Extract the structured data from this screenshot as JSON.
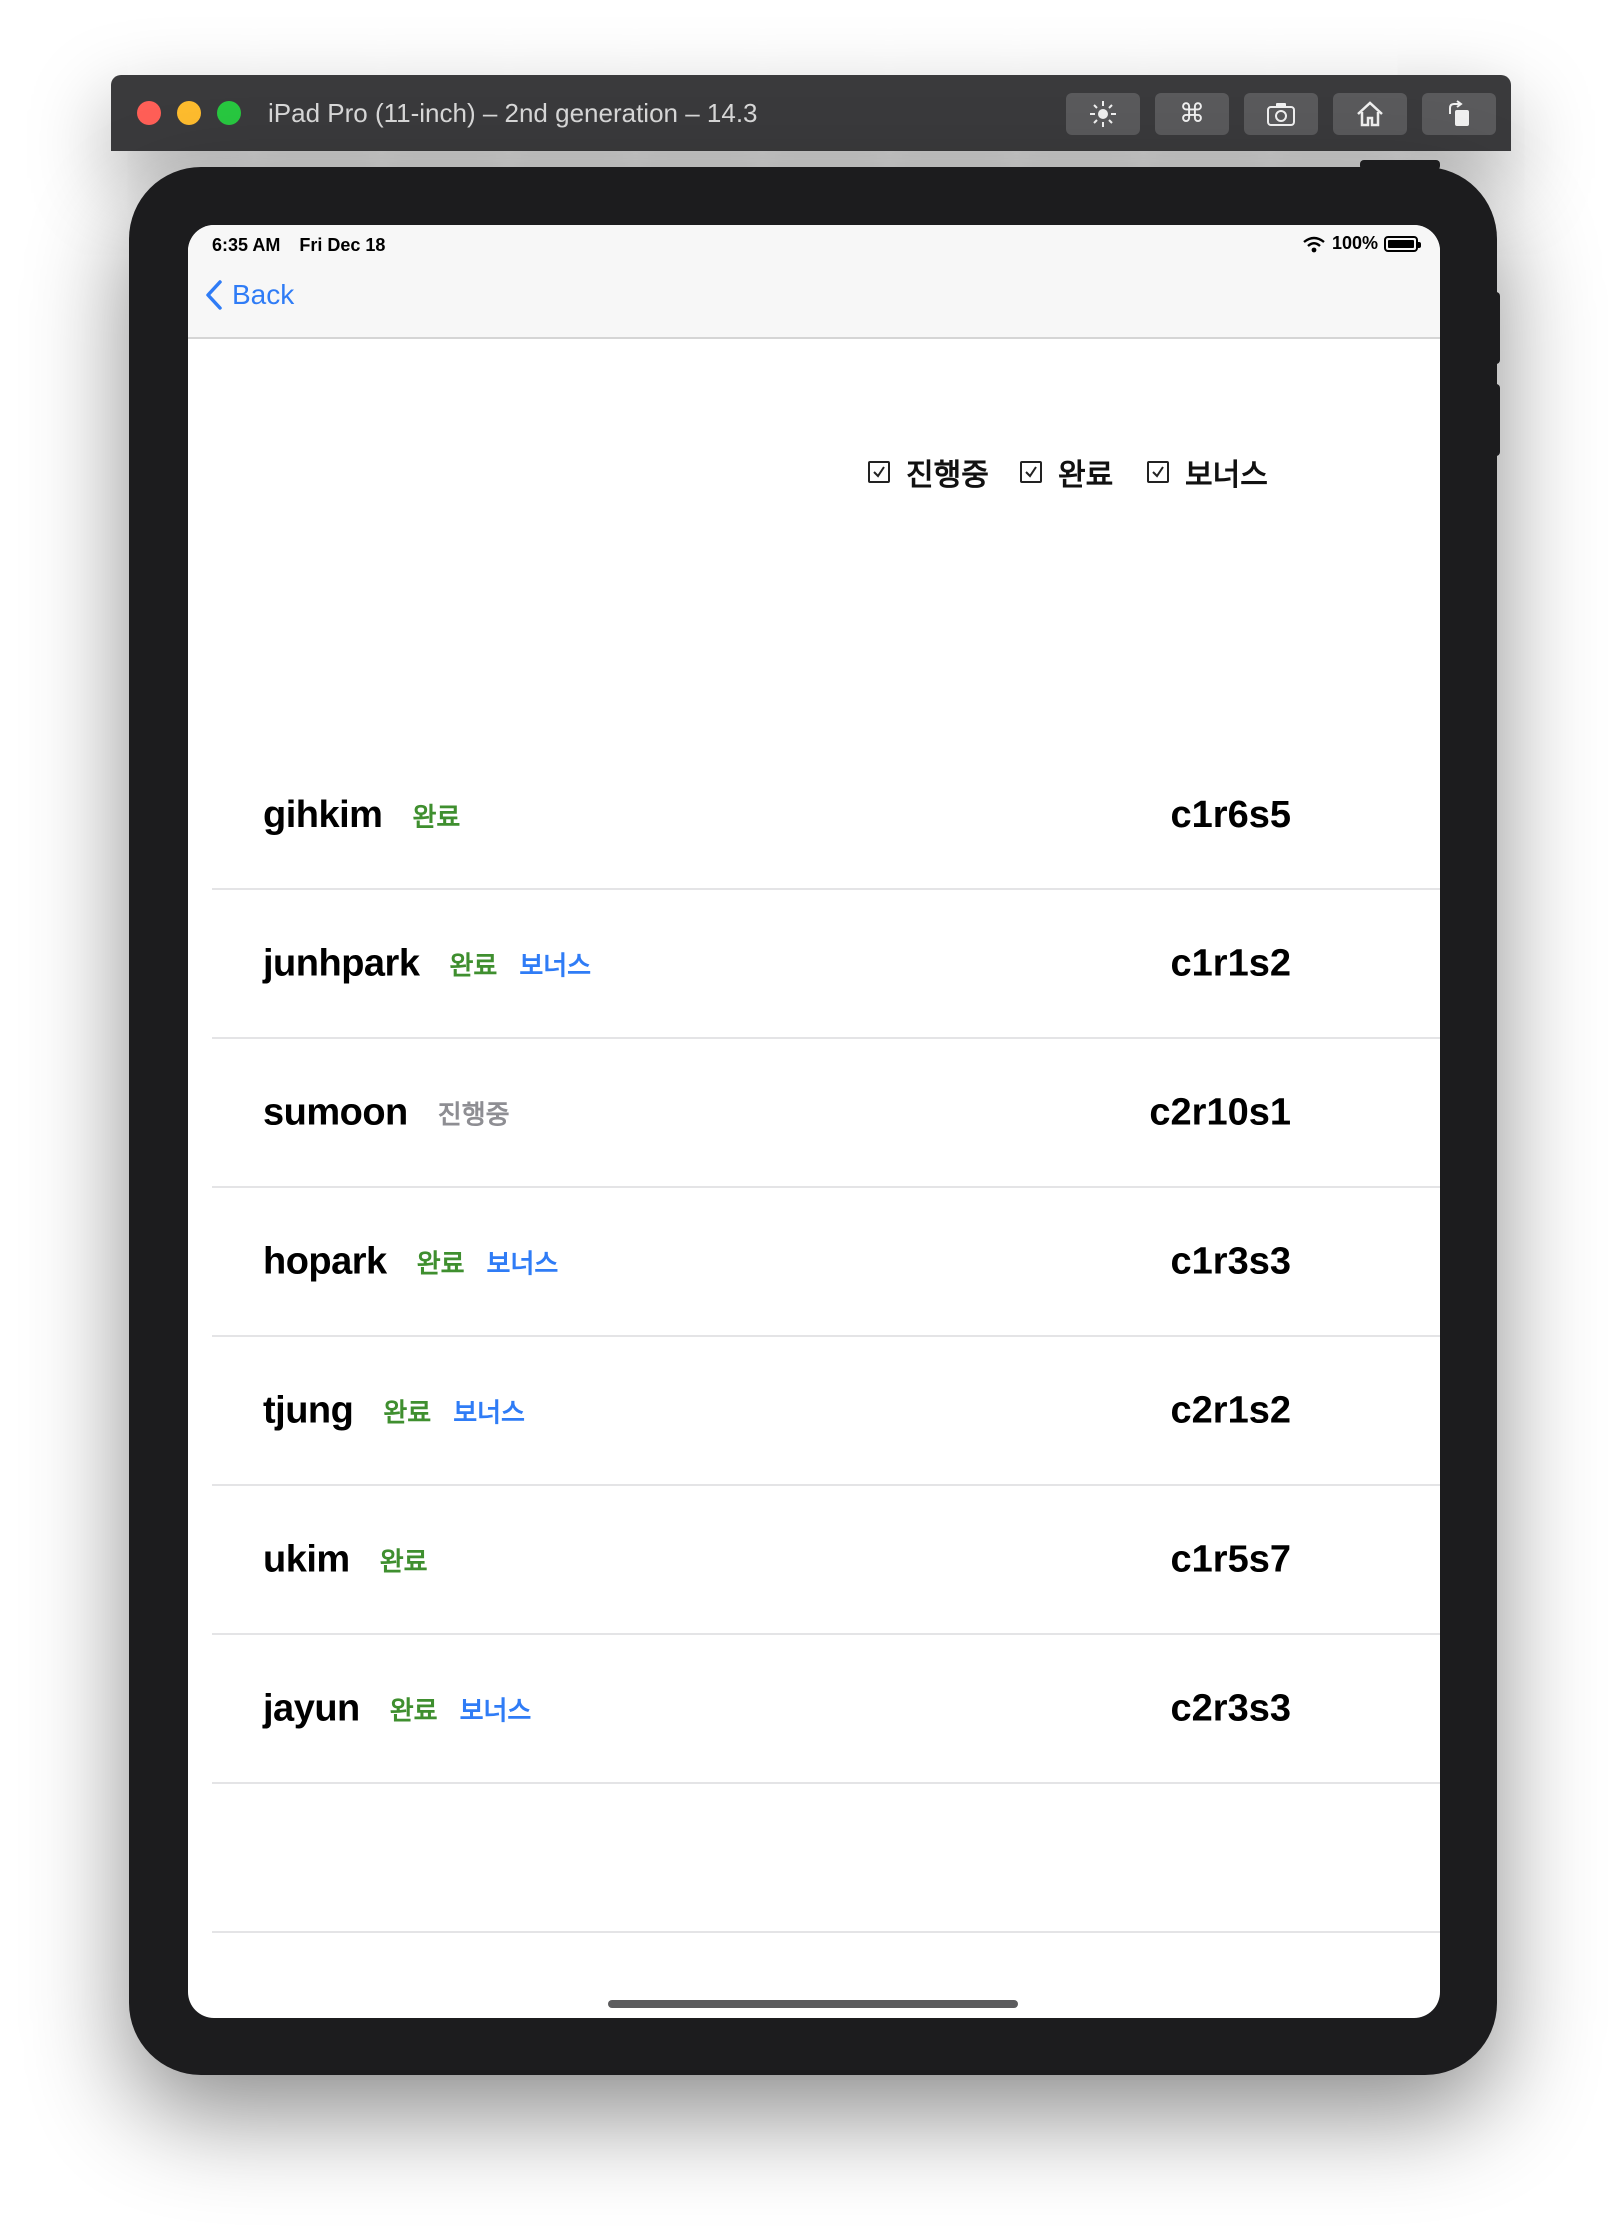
{
  "window": {
    "title": "iPad Pro (11-inch) – 2nd generation – 14.3",
    "toolbar_icons": [
      "brightness-icon",
      "command-icon",
      "screenshot-icon",
      "home-icon",
      "rotate-icon"
    ]
  },
  "status_bar": {
    "time": "6:35 AM",
    "date": "Fri Dec 18",
    "battery": "100%"
  },
  "nav": {
    "back_label": "Back"
  },
  "filters": {
    "in_progress": "진행중",
    "done": "완료",
    "bonus": "보너스"
  },
  "rows": [
    {
      "login": "gihkim",
      "tags": [
        "완료"
      ],
      "code": "c1r6s5"
    },
    {
      "login": "junhpark",
      "tags": [
        "완료",
        "보너스"
      ],
      "code": "c1r1s2"
    },
    {
      "login": "sumoon",
      "tags": [
        "진행중"
      ],
      "code": "c2r10s1"
    },
    {
      "login": "hopark",
      "tags": [
        "완료",
        "보너스"
      ],
      "code": "c1r3s3"
    },
    {
      "login": "tjung",
      "tags": [
        "완료",
        "보너스"
      ],
      "code": "c2r1s2"
    },
    {
      "login": "ukim",
      "tags": [
        "완료"
      ],
      "code": "c1r5s7"
    },
    {
      "login": "jayun",
      "tags": [
        "완료",
        "보너스"
      ],
      "code": "c2r3s3"
    }
  ],
  "colors": {
    "done": "#3f8f2f",
    "bonus": "#2f7cf6",
    "in_progress": "#8e8e93",
    "accent": "#2f7cf6"
  }
}
